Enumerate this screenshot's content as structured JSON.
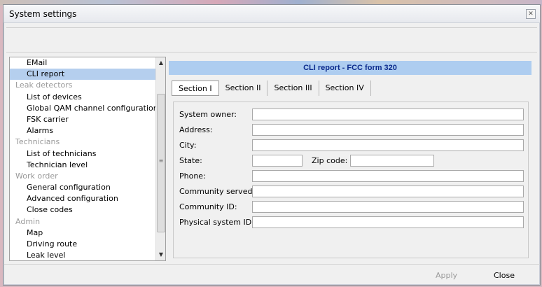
{
  "window": {
    "title": "System settings",
    "close_glyph": "✕"
  },
  "nav": {
    "items": [
      {
        "label": "EMail",
        "type": "item",
        "selected": false
      },
      {
        "label": "CLI report",
        "type": "item",
        "selected": true
      },
      {
        "label": "Leak detectors",
        "type": "header",
        "selected": false
      },
      {
        "label": "List of devices",
        "type": "item",
        "selected": false
      },
      {
        "label": "Global QAM channel configuration",
        "type": "item",
        "selected": false
      },
      {
        "label": "FSK carrier",
        "type": "item",
        "selected": false
      },
      {
        "label": "Alarms",
        "type": "item",
        "selected": false
      },
      {
        "label": "Technicians",
        "type": "header",
        "selected": false
      },
      {
        "label": "List of technicians",
        "type": "item",
        "selected": false
      },
      {
        "label": "Technician level",
        "type": "item",
        "selected": false
      },
      {
        "label": "Work order",
        "type": "header",
        "selected": false
      },
      {
        "label": "General configuration",
        "type": "item",
        "selected": false
      },
      {
        "label": "Advanced configuration",
        "type": "item",
        "selected": false
      },
      {
        "label": "Close codes",
        "type": "item",
        "selected": false
      },
      {
        "label": "Admin",
        "type": "header",
        "selected": false
      },
      {
        "label": "Map",
        "type": "item",
        "selected": false
      },
      {
        "label": "Driving route",
        "type": "item",
        "selected": false
      },
      {
        "label": "Leak level",
        "type": "item",
        "selected": false
      }
    ],
    "scroll_up_glyph": "▲",
    "scroll_down_glyph": "▼",
    "thumb_grip_glyph": "≡"
  },
  "panel": {
    "banner": "CLI report - FCC form 320",
    "tabs": [
      "Section I",
      "Section II",
      "Section III",
      "Section IV"
    ],
    "active_tab": 0
  },
  "form": {
    "system_owner": {
      "label": "System owner:",
      "value": ""
    },
    "address": {
      "label": "Address:",
      "value": ""
    },
    "city": {
      "label": "City:",
      "value": ""
    },
    "state": {
      "label": "State:",
      "value": ""
    },
    "zip": {
      "label": "Zip code:",
      "value": ""
    },
    "phone": {
      "label": "Phone:",
      "value": ""
    },
    "community_served": {
      "label": "Community served:",
      "value": ""
    },
    "community_id": {
      "label": "Community ID:",
      "value": ""
    },
    "physical_system_id": {
      "label": "Physical system ID:",
      "value": ""
    }
  },
  "buttons": {
    "apply": "Apply",
    "close": "Close"
  },
  "colors": {
    "banner_bg": "#aecdf0",
    "banner_text": "#0b2a8c",
    "selection": "#b5cfee",
    "header_text": "#9a9a9a"
  }
}
